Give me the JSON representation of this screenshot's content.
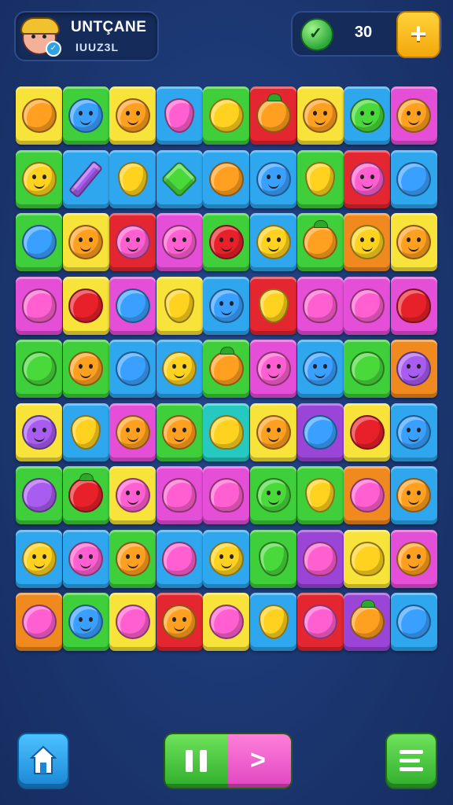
{
  "header": {
    "player_name": "UNTÇANE",
    "player_subtitle": "IUUZ3L",
    "coin_value": "30",
    "add_button_label": "+"
  },
  "icons": {
    "avatar": "player-avatar",
    "gem": "green-gem-icon",
    "home": "home-icon",
    "pause": "pause-icon",
    "play": "play-icon",
    "menu": "menu-icon"
  },
  "colors": {
    "background": "#1d3a78",
    "tile_yellow": "#f7e33a",
    "tile_green": "#3fcf3a",
    "tile_blue": "#2fa7ef",
    "tile_red": "#e3262f",
    "tile_pink": "#e54fd8",
    "tile_orange": "#f08a1e",
    "tile_purple": "#9a45d8",
    "tile_teal": "#25c9c0"
  },
  "board": {
    "rows": 9,
    "cols": 9,
    "tiles": [
      [
        [
          "yellow",
          "orange",
          "ball"
        ],
        [
          "green",
          "blue",
          "face"
        ],
        [
          "yellow",
          "orange",
          "face"
        ],
        [
          "blue",
          "pink",
          "drop"
        ],
        [
          "green",
          "yellow",
          "ball"
        ],
        [
          "red",
          "orange",
          "fruit"
        ],
        [
          "yellow",
          "orange",
          "face"
        ],
        [
          "blue",
          "green",
          "face"
        ],
        [
          "pink",
          "orange",
          "face"
        ]
      ],
      [
        [
          "green",
          "yellow",
          "face"
        ],
        [
          "blue",
          "purple",
          "pencil"
        ],
        [
          "blue",
          "yellow",
          "drop"
        ],
        [
          "blue",
          "green",
          "star"
        ],
        [
          "blue",
          "orange",
          "ball"
        ],
        [
          "blue",
          "blue",
          "face"
        ],
        [
          "green",
          "yellow",
          "drop"
        ],
        [
          "red",
          "pink",
          "face"
        ],
        [
          "blue",
          "blue",
          "ball"
        ]
      ],
      [
        [
          "green",
          "blue",
          "ball"
        ],
        [
          "yellow",
          "orange",
          "face"
        ],
        [
          "red",
          "pink",
          "face"
        ],
        [
          "pink",
          "pink",
          "face"
        ],
        [
          "green",
          "red",
          "face"
        ],
        [
          "blue",
          "yellow",
          "face"
        ],
        [
          "green",
          "orange",
          "fruit"
        ],
        [
          "orange",
          "yellow",
          "face"
        ],
        [
          "yellow",
          "orange",
          "face"
        ]
      ],
      [
        [
          "pink",
          "pink",
          "heart"
        ],
        [
          "yellow",
          "red",
          "ball"
        ],
        [
          "pink",
          "blue",
          "ball"
        ],
        [
          "yellow",
          "yellow",
          "drop"
        ],
        [
          "blue",
          "blue",
          "face"
        ],
        [
          "red",
          "yellow",
          "drop"
        ],
        [
          "pink",
          "pink",
          "heart"
        ],
        [
          "pink",
          "pink",
          "ball"
        ],
        [
          "pink",
          "red",
          "heart"
        ]
      ],
      [
        [
          "green",
          "green",
          "ball"
        ],
        [
          "green",
          "orange",
          "face"
        ],
        [
          "blue",
          "blue",
          "ball"
        ],
        [
          "blue",
          "yellow",
          "face"
        ],
        [
          "green",
          "orange",
          "fruit"
        ],
        [
          "pink",
          "pink",
          "face"
        ],
        [
          "blue",
          "blue",
          "face"
        ],
        [
          "green",
          "green",
          "ball"
        ],
        [
          "orange",
          "purple",
          "face"
        ]
      ],
      [
        [
          "yellow",
          "purple",
          "face"
        ],
        [
          "blue",
          "yellow",
          "drop"
        ],
        [
          "pink",
          "orange",
          "face"
        ],
        [
          "green",
          "orange",
          "face"
        ],
        [
          "teal",
          "yellow",
          "heart"
        ],
        [
          "yellow",
          "orange",
          "face"
        ],
        [
          "purple",
          "blue",
          "ball"
        ],
        [
          "yellow",
          "red",
          "ball"
        ],
        [
          "blue",
          "blue",
          "face"
        ]
      ],
      [
        [
          "green",
          "purple",
          "ball"
        ],
        [
          "green",
          "red",
          "fruit"
        ],
        [
          "yellow",
          "pink",
          "face"
        ],
        [
          "pink",
          "pink",
          "heart"
        ],
        [
          "pink",
          "pink",
          "heart"
        ],
        [
          "green",
          "green",
          "face"
        ],
        [
          "green",
          "yellow",
          "drop"
        ],
        [
          "orange",
          "pink",
          "ball"
        ],
        [
          "blue",
          "orange",
          "face"
        ]
      ],
      [
        [
          "blue",
          "yellow",
          "face"
        ],
        [
          "blue",
          "pink",
          "face"
        ],
        [
          "green",
          "orange",
          "face"
        ],
        [
          "blue",
          "pink",
          "heart"
        ],
        [
          "blue",
          "yellow",
          "face"
        ],
        [
          "green",
          "green",
          "drop"
        ],
        [
          "purple",
          "pink",
          "heart"
        ],
        [
          "yellow",
          "yellow",
          "heart"
        ],
        [
          "pink",
          "orange",
          "face"
        ]
      ],
      [
        [
          "orange",
          "pink",
          "ball"
        ],
        [
          "green",
          "blue",
          "face"
        ],
        [
          "yellow",
          "pink",
          "ball"
        ],
        [
          "red",
          "orange",
          "face"
        ],
        [
          "yellow",
          "pink",
          "ball"
        ],
        [
          "blue",
          "yellow",
          "drop"
        ],
        [
          "red",
          "pink",
          "ball"
        ],
        [
          "purple",
          "orange",
          "fruit"
        ],
        [
          "blue",
          "blue",
          "ball"
        ]
      ]
    ]
  }
}
